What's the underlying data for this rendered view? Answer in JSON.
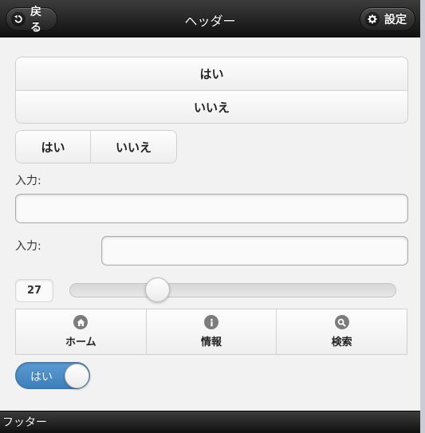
{
  "header": {
    "title": "ヘッダー",
    "back_label": "戻る",
    "settings_label": "設定"
  },
  "vertical_group": {
    "items": [
      {
        "label": "はい"
      },
      {
        "label": "いいえ"
      }
    ]
  },
  "horizontal_group": {
    "items": [
      {
        "label": "はい"
      },
      {
        "label": "いいえ"
      }
    ]
  },
  "form": {
    "input1_label": "入力:",
    "input1_value": "",
    "input2_label": "入力:",
    "input2_value": ""
  },
  "slider": {
    "value": "27",
    "min": 0,
    "max": 100
  },
  "navbar": {
    "items": [
      {
        "label": "ホーム",
        "icon": "home-icon"
      },
      {
        "label": "情報",
        "icon": "info-icon"
      },
      {
        "label": "検索",
        "icon": "search-icon"
      }
    ]
  },
  "flip_switch": {
    "label": "はい",
    "state": "on",
    "color": "#4a8ccb"
  },
  "footer": {
    "title": "フッター"
  }
}
